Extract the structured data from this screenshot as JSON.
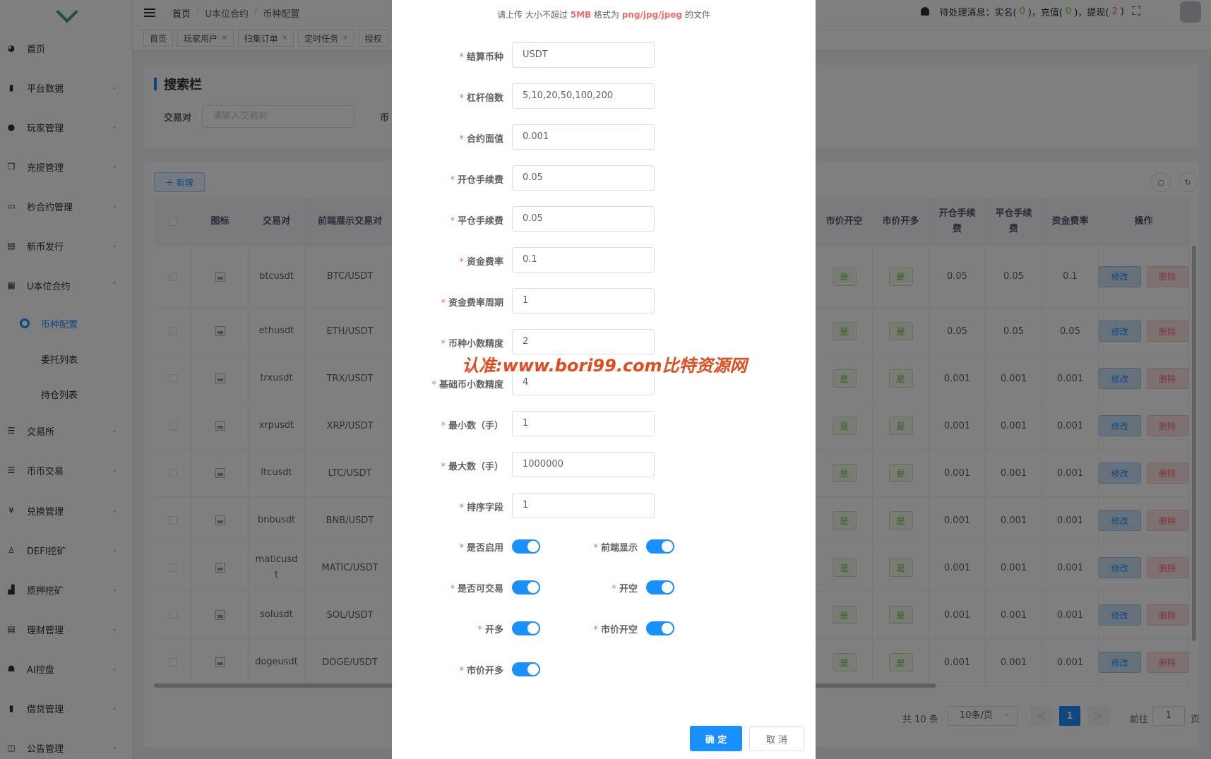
{
  "sidebar": {
    "items": [
      {
        "label": "首页",
        "icon": "dashboard-icon",
        "arrow": ""
      },
      {
        "label": "平台数据",
        "icon": "book-icon",
        "arrow": "⌄"
      },
      {
        "label": "玩家管理",
        "icon": "user-icon",
        "arrow": "⌄"
      },
      {
        "label": "充提管理",
        "icon": "copy-icon",
        "arrow": "⌄"
      },
      {
        "label": "秒合约管理",
        "icon": "monitor-icon",
        "arrow": "⌄"
      },
      {
        "label": "新币发行",
        "icon": "newspaper-icon",
        "arrow": "⌄"
      },
      {
        "label": "U本位合约",
        "icon": "grid-icon",
        "arrow": "⌃"
      }
    ],
    "subitems": [
      {
        "label": "币种配置"
      },
      {
        "label": "委托列表"
      },
      {
        "label": "持仓列表"
      }
    ],
    "items2": [
      {
        "label": "交易所",
        "icon": "list-icon",
        "arrow": "⌄"
      },
      {
        "label": "币币交易",
        "icon": "list-icon",
        "arrow": "⌄"
      },
      {
        "label": "兑换管理",
        "icon": "yen-icon",
        "arrow": "⌄"
      },
      {
        "label": "DEFI挖矿",
        "icon": "person-walk-icon",
        "arrow": "⌄"
      },
      {
        "label": "质押挖矿",
        "icon": "bar-chart-icon",
        "arrow": "⌄"
      },
      {
        "label": "理财管理",
        "icon": "document-icon",
        "arrow": "⌄"
      },
      {
        "label": "AI控盘",
        "icon": "robot-icon",
        "arrow": "⌄"
      },
      {
        "label": "借贷管理",
        "icon": "book-icon",
        "arrow": "⌄"
      },
      {
        "label": "公告管理",
        "icon": "open-book-icon",
        "arrow": "⌄"
      }
    ]
  },
  "header": {
    "breadcrumb": [
      "首页",
      "U本位合约",
      "币种配置"
    ],
    "notice": {
      "prefix": "待处理消息：实名(",
      "realname_count": "0",
      "mid1": ")，充值(",
      "recharge_count": "0",
      "mid2": ")，提现(",
      "withdraw_count": "2",
      "suffix": ")"
    }
  },
  "tags": [
    "首页",
    "玩家用户",
    "归集订单",
    "定时任务",
    "授权"
  ],
  "search": {
    "title": "搜索栏",
    "pair_label": "交易对",
    "pair_placeholder": "请输入交易对",
    "label2": "币"
  },
  "table": {
    "add_label": "＋ 新增",
    "left_headers": [
      "",
      "图标",
      "交易对",
      "前端展示交易对"
    ],
    "right_headers": [
      "市价开空",
      "市价开多",
      "开仓手续\n费",
      "平仓手续\n费",
      "资金费率",
      "操作"
    ],
    "rows": [
      {
        "pair": "btcusdt",
        "display": "BTC/USDT",
        "open_fee": "0.05",
        "close_fee": "0.05",
        "rate": "0.1"
      },
      {
        "pair": "ethusdt",
        "display": "ETH/USDT",
        "open_fee": "0.05",
        "close_fee": "0.05",
        "rate": "0.05"
      },
      {
        "pair": "trxusdt",
        "display": "TRX/USDT",
        "open_fee": "0.001",
        "close_fee": "0.001",
        "rate": "0.001"
      },
      {
        "pair": "xrpusdt",
        "display": "XRP/USDT",
        "open_fee": "0.001",
        "close_fee": "0.001",
        "rate": "0.001"
      },
      {
        "pair": "ltcusdt",
        "display": "LTC/USDT",
        "open_fee": "0.001",
        "close_fee": "0.001",
        "rate": "0.001"
      },
      {
        "pair": "bnbusdt",
        "display": "BNB/USDT",
        "open_fee": "0.001",
        "close_fee": "0.001",
        "rate": "0.001"
      },
      {
        "pair": "maticusd\nt",
        "display": "MATIC/USDT",
        "open_fee": "0.001",
        "close_fee": "0.001",
        "rate": "0.001"
      },
      {
        "pair": "solusdt",
        "display": "SOL/USDT",
        "open_fee": "0.001",
        "close_fee": "0.001",
        "rate": "0.001"
      },
      {
        "pair": "dogeusdt",
        "display": "DOGE/USDT",
        "open_fee": "0.001",
        "close_fee": "0.001",
        "rate": "0.001"
      }
    ],
    "yes_label": "是",
    "edit_label": "修改",
    "delete_label": "删除"
  },
  "pager": {
    "total": "共 10 条",
    "page_size": "10条/页",
    "prev": "＜",
    "current": "1",
    "next": "＞",
    "goto_label": "前往",
    "goto_value": "1",
    "page_suffix": "页"
  },
  "dialog": {
    "upload_hint_prefix": "请上传 大小不超过 ",
    "upload_hint_size": "5MB",
    "upload_hint_mid": " 格式为 ",
    "upload_hint_formats": "png/jpg/jpeg",
    "upload_hint_suffix": " 的文件",
    "fields": [
      {
        "label": "结算币种",
        "value": "USDT"
      },
      {
        "label": "杠杆倍数",
        "value": "5,10,20,50,100,200"
      },
      {
        "label": "合约面值",
        "value": "0.001"
      },
      {
        "label": "开仓手续费",
        "value": "0.05"
      },
      {
        "label": "平仓手续费",
        "value": "0.05"
      },
      {
        "label": "资金费率",
        "value": "0.1"
      },
      {
        "label": "资金费率周期",
        "value": "1"
      },
      {
        "label": "币种小数精度",
        "value": "2"
      },
      {
        "label": "基础币小数精度",
        "value": "4"
      },
      {
        "label": "最小数（手）",
        "value": "1"
      },
      {
        "label": "最大数（手）",
        "value": "1000000"
      },
      {
        "label": "排序字段",
        "value": "1"
      }
    ],
    "switches": [
      {
        "label": "是否启用",
        "on": true
      },
      {
        "label": "前端显示",
        "on": true
      },
      {
        "label": "是否可交易",
        "on": true
      },
      {
        "label": "开空",
        "on": true
      },
      {
        "label": "开多",
        "on": true
      },
      {
        "label": "市价开空",
        "on": true
      },
      {
        "label": "市价开多",
        "on": true
      }
    ],
    "confirm": "确 定",
    "cancel": "取 消"
  },
  "watermark": "认准:www.bori99.com比特资源网",
  "colors": {
    "primary": "#1890ff",
    "success": "#67c23a",
    "danger": "#f56c6c",
    "brand": "#36a572"
  }
}
